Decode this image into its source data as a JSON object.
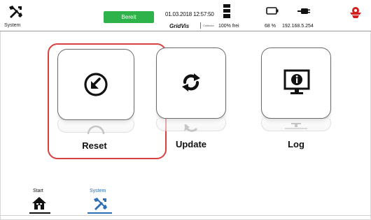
{
  "status_bar": {
    "system_label": "System",
    "ready_label": "Bereit",
    "datetime": "01.03.2018 12:57:50",
    "brand": "GridVis",
    "brand_sub": "Collector",
    "storage_text": "100% frei",
    "battery_text": "68 %",
    "ip_text": "192.168.5.254",
    "colors": {
      "ready": "#2db34a",
      "alert": "#d02020"
    }
  },
  "tiles": [
    {
      "label": "Reset",
      "icon": "reset-arrow-icon",
      "selected": true
    },
    {
      "label": "Update",
      "icon": "refresh-icon",
      "selected": false
    },
    {
      "label": "Log",
      "icon": "monitor-info-icon",
      "selected": false
    }
  ],
  "bottom_nav": {
    "items": [
      {
        "label": "Start",
        "icon": "home-icon",
        "active": false
      },
      {
        "label": "System",
        "icon": "tools-icon",
        "active": true
      }
    ],
    "active_color": "#2b6fb5"
  }
}
